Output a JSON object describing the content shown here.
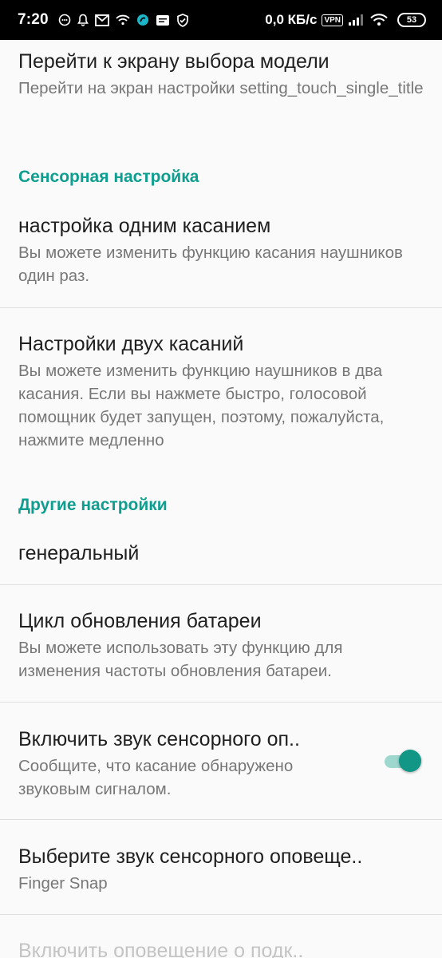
{
  "status_bar": {
    "time": "7:20",
    "network_speed": "0,0 КБ/с",
    "vpn_label": "VPN",
    "battery_level": "53",
    "colors": {
      "background": "#000000",
      "foreground": "#ffffff"
    },
    "icons": [
      "messenger-icon",
      "bell-icon",
      "mail-icon",
      "wifi-icon",
      "app-icon",
      "message-icon",
      "shield-icon",
      "signal-icon",
      "wifi-icon"
    ]
  },
  "items": {
    "model_select": {
      "title": "Перейти к экрану выбора модели",
      "summary": "Перейти на экран настройки setting_touch_single_title"
    },
    "single_touch": {
      "title": "настройка одним касанием",
      "summary": "Вы можете изменить функцию касания наушников один раз."
    },
    "double_touch": {
      "title": "Настройки двух касаний",
      "summary": "Вы можете изменить функцию наушников в два касания. Если вы нажмете быстро, голосовой помощник будет запущен, поэтому, пожалуйста, нажмите медленно"
    },
    "general": {
      "title": "генеральный"
    },
    "battery_cycle": {
      "title": "Цикл обновления батареи",
      "summary": "Вы можете использовать эту функцию для изменения частоты обновления батареи."
    },
    "touch_sound": {
      "title": "Включить звук сенсорного оп..",
      "summary": "Сообщите, что касание обнаружено звуковым сигналом.",
      "enabled": true
    },
    "touch_sound_select": {
      "title": "Выберите звук сенсорного оповеще..",
      "summary": "Finger Snap"
    },
    "connect_alert": {
      "title": "Включить оповещение о подк.."
    }
  },
  "categories": {
    "touch": "Сенсорная настройка",
    "other": "Другие настройки"
  },
  "colors": {
    "accent": "#0e9e8f",
    "switch_thumb": "#129685",
    "switch_track": "#9ed7ce",
    "background": "#fafafa"
  }
}
